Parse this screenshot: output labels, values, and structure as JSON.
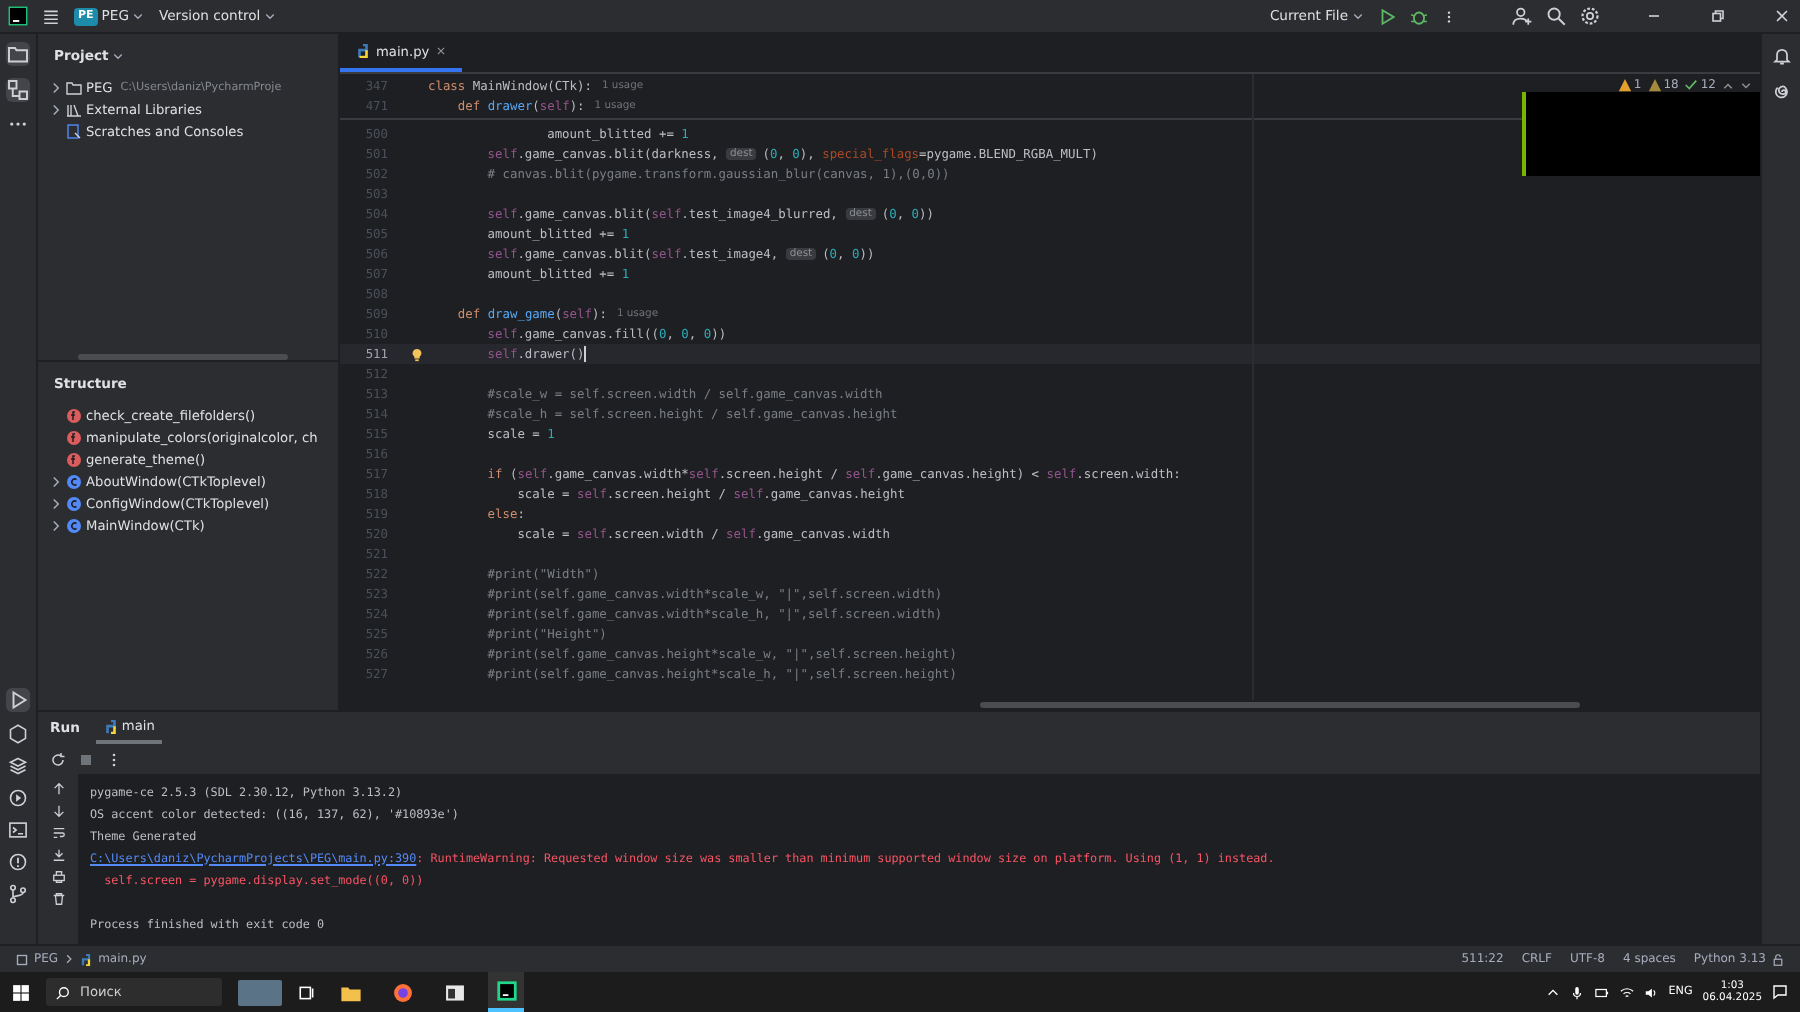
{
  "titlebar": {
    "project_badge": "PE",
    "project": "PEG",
    "vcs": "Version control",
    "run_config": "Current File"
  },
  "project_panel": {
    "title": "Project",
    "items": [
      {
        "kind": "folder",
        "label": "PEG",
        "path": "C:\\Users\\daniz\\PycharmProje",
        "expandable": true
      },
      {
        "kind": "library",
        "label": "External Libraries",
        "expandable": true
      },
      {
        "kind": "scratch",
        "label": "Scratches and Consoles",
        "expandable": false
      }
    ]
  },
  "structure": {
    "title": "Structure",
    "items": [
      {
        "kind": "function",
        "label": "check_create_filefolders()",
        "expandable": false
      },
      {
        "kind": "function",
        "label": "manipulate_colors(originalcolor, ch",
        "expandable": false
      },
      {
        "kind": "function",
        "label": "generate_theme()",
        "expandable": false
      },
      {
        "kind": "class",
        "label": "AboutWindow(CTkToplevel)",
        "expandable": true
      },
      {
        "kind": "class",
        "label": "ConfigWindow(CTkToplevel)",
        "expandable": true
      },
      {
        "kind": "class",
        "label": "MainWindow(CTk)",
        "expandable": true
      }
    ]
  },
  "editor": {
    "tabs": [
      {
        "label": "main.py",
        "selected": true
      }
    ],
    "inspections": {
      "errors": "1",
      "warnings": "18",
      "passed": "12"
    },
    "sticky": [
      {
        "number": "347",
        "tokens": [
          {
            "text": "class ",
            "kind": "keyword"
          },
          {
            "text": "MainWindow(CTk):",
            "kind": "plain"
          },
          {
            "text": "1 usage",
            "kind": "usage"
          }
        ]
      },
      {
        "number": "471",
        "tokens": [
          {
            "text": "    def ",
            "kind": "keyword"
          },
          {
            "text": "drawer",
            "kind": "function"
          },
          {
            "text": "(",
            "kind": "plain"
          },
          {
            "text": "self",
            "kind": "self"
          },
          {
            "text": "):",
            "kind": "plain"
          },
          {
            "text": "1 usage",
            "kind": "usage"
          }
        ]
      }
    ],
    "lines": [
      {
        "number": "500",
        "current": false,
        "tokens": [
          {
            "text": "                amount_blitted += ",
            "kind": "plain"
          },
          {
            "text": "1",
            "kind": "number"
          }
        ]
      },
      {
        "number": "501",
        "current": false,
        "tokens": [
          {
            "text": "        self",
            "kind": "self"
          },
          {
            "text": ".game_canvas.blit(darkness, ",
            "kind": "plain"
          },
          {
            "text": "dest",
            "kind": "hint"
          },
          {
            "text": "(",
            "kind": "plain"
          },
          {
            "text": "0",
            "kind": "number"
          },
          {
            "text": ", ",
            "kind": "plain"
          },
          {
            "text": "0",
            "kind": "number"
          },
          {
            "text": "), ",
            "kind": "plain"
          },
          {
            "text": "special_flags",
            "kind": "param"
          },
          {
            "text": "=pygame.BLEND_RGBA_MULT)",
            "kind": "plain"
          }
        ]
      },
      {
        "number": "502",
        "current": false,
        "tokens": [
          {
            "text": "        # canvas.blit(pygame.transform.gaussian_blur(canvas, 1),(0,0))",
            "kind": "comment"
          }
        ]
      },
      {
        "number": "503",
        "current": false
      },
      {
        "number": "504",
        "current": false,
        "tokens": [
          {
            "text": "        self",
            "kind": "self"
          },
          {
            "text": ".game_canvas.blit(",
            "kind": "plain"
          },
          {
            "text": "self",
            "kind": "self"
          },
          {
            "text": ".test_image4_blurred, ",
            "kind": "plain"
          },
          {
            "text": "dest",
            "kind": "hint"
          },
          {
            "text": "(",
            "kind": "plain"
          },
          {
            "text": "0",
            "kind": "number"
          },
          {
            "text": ", ",
            "kind": "plain"
          },
          {
            "text": "0",
            "kind": "number"
          },
          {
            "text": "))",
            "kind": "plain"
          }
        ]
      },
      {
        "number": "505",
        "current": false,
        "tokens": [
          {
            "text": "        amount_blitted += ",
            "kind": "plain"
          },
          {
            "text": "1",
            "kind": "number"
          }
        ]
      },
      {
        "number": "506",
        "current": false,
        "tokens": [
          {
            "text": "        self",
            "kind": "self"
          },
          {
            "text": ".game_canvas.blit(",
            "kind": "plain"
          },
          {
            "text": "self",
            "kind": "self"
          },
          {
            "text": ".test_image4, ",
            "kind": "plain"
          },
          {
            "text": "dest",
            "kind": "hint"
          },
          {
            "text": "(",
            "kind": "plain"
          },
          {
            "text": "0",
            "kind": "number"
          },
          {
            "text": ", ",
            "kind": "plain"
          },
          {
            "text": "0",
            "kind": "number"
          },
          {
            "text": "))",
            "kind": "plain"
          }
        ]
      },
      {
        "number": "507",
        "current": false,
        "tokens": [
          {
            "text": "        amount_blitted += ",
            "kind": "plain"
          },
          {
            "text": "1",
            "kind": "number"
          }
        ]
      },
      {
        "number": "508",
        "current": false
      },
      {
        "number": "509",
        "current": false,
        "tokens": [
          {
            "text": "    def ",
            "kind": "keyword"
          },
          {
            "text": "draw_game",
            "kind": "function"
          },
          {
            "text": "(",
            "kind": "plain"
          },
          {
            "text": "self",
            "kind": "self"
          },
          {
            "text": "):",
            "kind": "plain"
          },
          {
            "text": "1 usage",
            "kind": "usage"
          }
        ]
      },
      {
        "number": "510",
        "current": false,
        "tokens": [
          {
            "text": "        self",
            "kind": "self"
          },
          {
            "text": ".game_canvas.fill((",
            "kind": "plain"
          },
          {
            "text": "0",
            "kind": "number"
          },
          {
            "text": ", ",
            "kind": "plain"
          },
          {
            "text": "0",
            "kind": "number"
          },
          {
            "text": ", ",
            "kind": "plain"
          },
          {
            "text": "0",
            "kind": "number"
          },
          {
            "text": "))",
            "kind": "plain"
          }
        ]
      },
      {
        "number": "511",
        "current": true,
        "tokens": [
          {
            "text": "        self",
            "kind": "self"
          },
          {
            "text": ".drawer()",
            "kind": "plain"
          }
        ]
      },
      {
        "number": "512",
        "current": false
      },
      {
        "number": "513",
        "current": false,
        "tokens": [
          {
            "text": "        #scale_w = self.screen.width / self.game_canvas.width",
            "kind": "comment"
          }
        ]
      },
      {
        "number": "514",
        "current": false,
        "tokens": [
          {
            "text": "        #scale_h = self.screen.height / self.game_canvas.height",
            "kind": "comment"
          }
        ]
      },
      {
        "number": "515",
        "current": false,
        "tokens": [
          {
            "text": "        scale = ",
            "kind": "plain"
          },
          {
            "text": "1",
            "kind": "number"
          }
        ]
      },
      {
        "number": "516",
        "current": false
      },
      {
        "number": "517",
        "current": false,
        "tokens": [
          {
            "text": "        if ",
            "kind": "keyword"
          },
          {
            "text": "(",
            "kind": "plain"
          },
          {
            "text": "self",
            "kind": "self"
          },
          {
            "text": ".game_canvas.width*",
            "kind": "plain"
          },
          {
            "text": "self",
            "kind": "self"
          },
          {
            "text": ".screen.height / ",
            "kind": "plain"
          },
          {
            "text": "self",
            "kind": "self"
          },
          {
            "text": ".game_canvas.height) < ",
            "kind": "plain"
          },
          {
            "text": "self",
            "kind": "self"
          },
          {
            "text": ".screen.width:",
            "kind": "plain"
          }
        ]
      },
      {
        "number": "518",
        "current": false,
        "tokens": [
          {
            "text": "            scale = ",
            "kind": "plain"
          },
          {
            "text": "self",
            "kind": "self"
          },
          {
            "text": ".screen.height / ",
            "kind": "plain"
          },
          {
            "text": "self",
            "kind": "self"
          },
          {
            "text": ".game_canvas.height",
            "kind": "plain"
          }
        ]
      },
      {
        "number": "519",
        "current": false,
        "tokens": [
          {
            "text": "        else",
            "kind": "keyword"
          },
          {
            "text": ":",
            "kind": "plain"
          }
        ]
      },
      {
        "number": "520",
        "current": false,
        "tokens": [
          {
            "text": "            scale = ",
            "kind": "plain"
          },
          {
            "text": "self",
            "kind": "self"
          },
          {
            "text": ".screen.width / ",
            "kind": "plain"
          },
          {
            "text": "self",
            "kind": "self"
          },
          {
            "text": ".game_canvas.width",
            "kind": "plain"
          }
        ]
      },
      {
        "number": "521",
        "current": false
      },
      {
        "number": "522",
        "current": false,
        "tokens": [
          {
            "text": "        #print(\"Width\")",
            "kind": "comment"
          }
        ]
      },
      {
        "number": "523",
        "current": false,
        "tokens": [
          {
            "text": "        #print(self.game_canvas.width*scale_w, \"|\",self.screen.width)",
            "kind": "comment"
          }
        ]
      },
      {
        "number": "524",
        "current": false,
        "tokens": [
          {
            "text": "        #print(self.game_canvas.width*scale_h, \"|\",self.screen.width)",
            "kind": "comment"
          }
        ]
      },
      {
        "number": "525",
        "current": false,
        "tokens": [
          {
            "text": "        #print(\"Height\")",
            "kind": "comment"
          }
        ]
      },
      {
        "number": "526",
        "current": false,
        "tokens": [
          {
            "text": "        #print(self.game_canvas.height*scale_w, \"|\",self.screen.height)",
            "kind": "comment"
          }
        ]
      },
      {
        "number": "527",
        "current": false,
        "tokens": [
          {
            "text": "        #print(self.game_canvas.height*scale_h, \"|\",self.screen.height)",
            "kind": "comment"
          }
        ]
      }
    ]
  },
  "run_panel": {
    "title": "Run",
    "tabs": [
      {
        "label": "main",
        "selected": true
      }
    ],
    "output": [
      {
        "kind": "stdout",
        "tokens": [
          {
            "text": "pygame-ce 2.5.3 (SDL 2.30.12, Python 3.13.2)",
            "kind": "output"
          }
        ]
      },
      {
        "kind": "stdout",
        "tokens": [
          {
            "text": "OS accent color detected: ((16, 137, 62), '#10893e')",
            "kind": "output"
          }
        ]
      },
      {
        "kind": "stdout",
        "tokens": [
          {
            "text": "Theme Generated",
            "kind": "output"
          }
        ]
      },
      {
        "kind": "stderr",
        "tokens": [
          {
            "text": "C:\\Users\\daniz\\PycharmProjects\\PEG\\main.py:390",
            "kind": "link"
          },
          {
            "text": ": RuntimeWarning: Requested window size was smaller than minimum supported window size on platform. Using (1, 1) instead.",
            "kind": "error"
          }
        ]
      },
      {
        "kind": "stderr",
        "tokens": [
          {
            "text": "  self.screen = pygame.display.set_mode((0, 0))",
            "kind": "error"
          }
        ]
      },
      {
        "kind": "exit",
        "tokens": [
          {
            "text": "Process finished with exit code 0",
            "kind": "output"
          }
        ]
      }
    ]
  },
  "status_bar": {
    "breadcrumbs": [
      "PEG",
      "main.py"
    ],
    "items": [
      "511:22",
      "CRLF",
      "UTF-8",
      "4 spaces",
      "Python 3.13"
    ]
  },
  "taskbar": {
    "search": {
      "placeholder": "Поиск"
    },
    "language": "ENG",
    "time": "1:03",
    "date": "06.04.2025"
  }
}
